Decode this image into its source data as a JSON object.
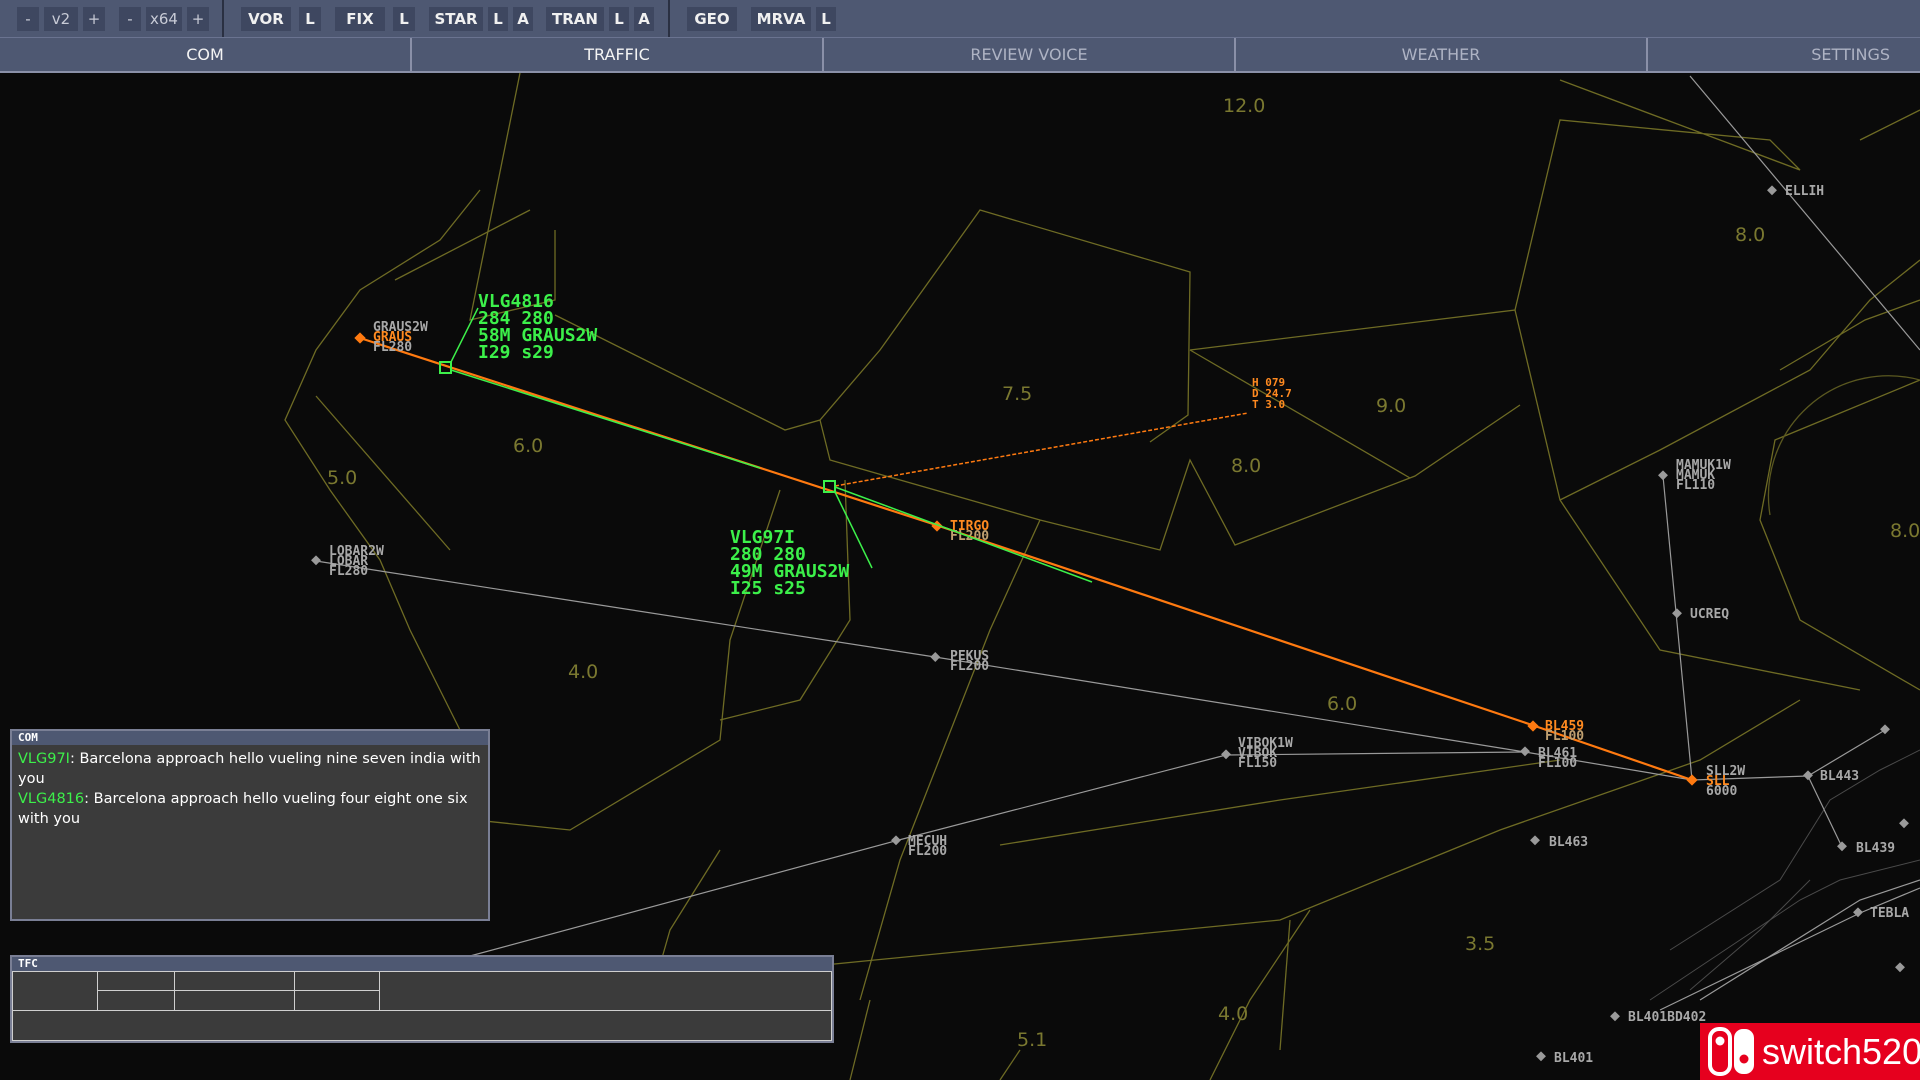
{
  "toolbar": {
    "minus1": "-",
    "version": "v2",
    "plus1": "+",
    "minus2": "-",
    "zoom": "x64",
    "plus2": "+",
    "vor": "VOR",
    "vor_l": "L",
    "fix": "FIX",
    "fix_l": "L",
    "star": "STAR",
    "star_l": "L",
    "star_a": "A",
    "tran": "TRAN",
    "tran_l": "L",
    "tran_a": "A",
    "geo": "GEO",
    "mrva": "MRVA",
    "mrva_l": "L"
  },
  "tabs": [
    "COM",
    "TRAFFIC",
    "REVIEW VOICE",
    "WEATHER",
    "SETTINGS"
  ],
  "colors": {
    "sector": "#6e6b24",
    "active_route": "#ff7a10",
    "aircraft_tag": "#3cf04a",
    "route": "#9a9a9a",
    "panel_header": "#4e5872"
  },
  "map": {
    "altitudes": [
      "12.0",
      "8.0",
      "7.5",
      "9.0",
      "6.0",
      "5.0",
      "8.0",
      "8.0",
      "4.0",
      "6.0",
      "3.5",
      "4.0",
      "5.1"
    ],
    "waypoints": {
      "graus": [
        "GRAUS2W",
        "GRAUS",
        "FL280"
      ],
      "lobar": [
        "LOBAR2W",
        "LOBAR",
        "FL280"
      ],
      "tirgo": [
        "TIRGO",
        "FL200"
      ],
      "pekus": [
        "PEKUS",
        "FL200"
      ],
      "vibok": [
        "VIBOK1W",
        "VIBOK",
        "FL150"
      ],
      "mecuh": [
        "MECUH",
        "FL200"
      ],
      "bl459": [
        "BL459",
        "FL100"
      ],
      "bl461": [
        "BL461",
        "FL100"
      ],
      "sll": [
        "SLL2W",
        "SLL",
        "6000"
      ],
      "bl443": "BL443",
      "bl439": "BL439",
      "bl463": "BL463",
      "bl401": "BL401",
      "bl402": "BL401BD402",
      "mamuk": [
        "MAMUK1W",
        "MAMUK",
        "FL110"
      ],
      "ucreq": "UCREQ",
      "ellih": "ELLIH",
      "tebla": "TEBLA"
    },
    "hdt": [
      "H 079",
      "D 24.7",
      "T 3.0"
    ]
  },
  "aircraft": [
    {
      "callsign": "VLG4816",
      "line2": "284 280",
      "line3": "58M GRAUS2W",
      "line4": "I29 s29"
    },
    {
      "callsign": "VLG97I",
      "line2": "280 280",
      "line3": "49M GRAUS2W",
      "line4": "I25 s25"
    }
  ],
  "com_panel": {
    "title": "COM",
    "messages": [
      {
        "callsign": "VLG97I",
        "text": ": Barcelona approach hello vueling nine seven india with you"
      },
      {
        "callsign": "VLG4816",
        "text": ": Barcelona approach hello vueling four eight one six with you"
      }
    ]
  },
  "tfc_panel": {
    "title": "TFC"
  },
  "logo": {
    "text": "switch520"
  }
}
